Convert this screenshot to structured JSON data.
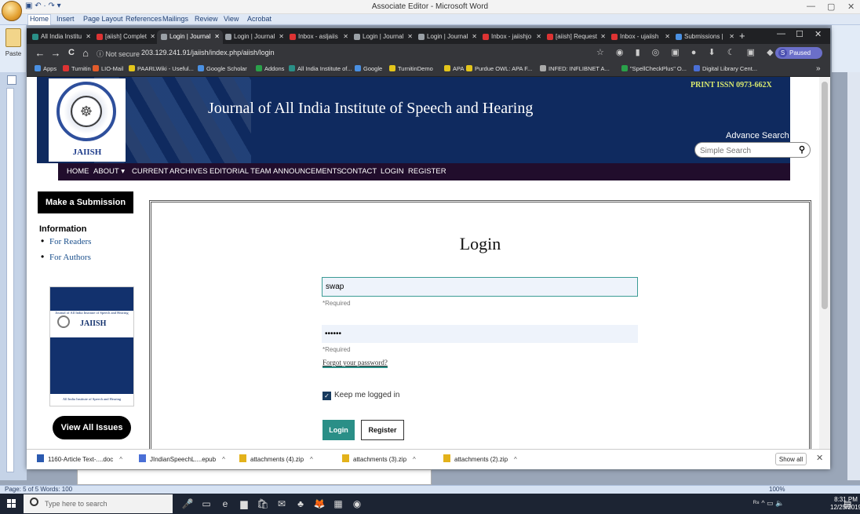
{
  "word": {
    "title": "Associate Editor - Microsoft Word",
    "qat": "▣ ↶ · ↷ ▾",
    "tabs": [
      "Home",
      "Insert",
      "Page Layout",
      "References",
      "Mailings",
      "Review",
      "View",
      "Acrobat"
    ],
    "paste_label": "Paste",
    "status_text": "Page: 5 of 5   Words: 100",
    "zoom": "100%",
    "win_controls": {
      "minimize": "—",
      "restore": "▢",
      "close": "✕"
    }
  },
  "browser": {
    "tabs": [
      {
        "label": "All India Institu",
        "color": "#2a8f87"
      },
      {
        "label": "[aiish] Complet",
        "color": "#d33"
      },
      {
        "label": "Login | Journal",
        "color": "#9aa0a6",
        "active": true
      },
      {
        "label": "Login | Journal",
        "color": "#9aa0a6"
      },
      {
        "label": "Inbox - asljaiis",
        "color": "#d33"
      },
      {
        "label": "Login | Journal",
        "color": "#9aa0a6"
      },
      {
        "label": "Login | Journal",
        "color": "#9aa0a6"
      },
      {
        "label": "Inbox - jaiishjo",
        "color": "#d33"
      },
      {
        "label": "[aiish] Request",
        "color": "#d33"
      },
      {
        "label": "Inbox - ujaiish",
        "color": "#d33"
      },
      {
        "label": "Submissions |",
        "color": "#4a90e2"
      }
    ],
    "new_tab": "+",
    "controls": {
      "minimize": "—",
      "maximize": "☐",
      "close": "✕"
    },
    "nav": {
      "back": "←",
      "forward": "→",
      "reload": "C",
      "home": "⌂"
    },
    "not_secure": "ⓘ Not secure",
    "url": "203.129.241.91/jaiish/index.php/aiish/login",
    "ext_icons": "☆ ◉ ▮ ◎ ▣ ● ⬇ ☾ ▣ ◆ ▦ ⊶",
    "profile": "Paused",
    "profile_initial": "S",
    "bookmarks": [
      {
        "label": "Apps",
        "color": "#4a90e2"
      },
      {
        "label": "Turnitin",
        "color": "#d33"
      },
      {
        "label": "LIO-Mail",
        "color": "#e25b2b"
      },
      {
        "label": "PAARLWiki - Useful...",
        "color": "#e3c51b"
      },
      {
        "label": "Google Scholar",
        "color": "#4a90e2"
      },
      {
        "label": "Addons",
        "color": "#2aa14a"
      },
      {
        "label": "All India Institute of...",
        "color": "#2a8f87"
      },
      {
        "label": "Google",
        "color": "#4a90e2"
      },
      {
        "label": "TurnitinDemo",
        "color": "#e3c51b"
      },
      {
        "label": "APA",
        "color": "#e3c51b"
      },
      {
        "label": "Purdue OWL: APA F...",
        "color": "#e3c51b"
      },
      {
        "label": "INFED: INFLIBNET A...",
        "color": "#aaa"
      },
      {
        "label": "\"SpellCheckPlus\" O...",
        "color": "#2aa14a"
      },
      {
        "label": "Digital Library Cent...",
        "color": "#4a6fd6"
      }
    ],
    "bookmarks_more": "»"
  },
  "journal": {
    "logo_text": "JAIISH",
    "title": "Journal of All India Institute of Speech and Hearing",
    "print_issn": "PRINT ISSN 0973-662X",
    "advance_search": "Advance Search",
    "search_placeholder": "Simple Search",
    "nav": [
      "HOME",
      "ABOUT ▾",
      "CURRENT",
      "ARCHIVES",
      "EDITORIAL TEAM",
      "ANNOUNCEMENTS",
      "CONTACT",
      "LOGIN",
      "REGISTER"
    ]
  },
  "sidebar": {
    "submit_label": "Make a Submission",
    "info_title": "Information",
    "info_links": [
      "For Readers",
      "For Authors"
    ],
    "cover": {
      "journal": "Journal of All India Institute of Speech and Hearing",
      "title": "JAIISH",
      "foot": "All India Institute of Speech and Hearing"
    },
    "view_issues": "View All Issues"
  },
  "login": {
    "title": "Login",
    "username_value": "swap",
    "password_value": "••••••",
    "required": "*Required",
    "forgot": "Forgot your password?",
    "keep_logged_in": "Keep me logged in",
    "keep_checked": true,
    "login_button": "Login",
    "register_button": "Register"
  },
  "downloads": {
    "items": [
      {
        "label": "1160-Article Text-....doc",
        "color": "#2b5ab0"
      },
      {
        "label": "JIndianSpeechL....epub",
        "color": "#4a6fd6"
      },
      {
        "label": "attachments (4).zip",
        "color": "#e3b21b"
      },
      {
        "label": "attachments (3).zip",
        "color": "#e3b21b"
      },
      {
        "label": "attachments (2).zip",
        "color": "#e3b21b"
      }
    ],
    "show_all": "Show all",
    "close": "✕"
  },
  "taskbar": {
    "search_text": "Type here to search",
    "apps": [
      "🎤",
      "▭",
      "e",
      "▆",
      "🛍",
      "✉",
      "♣",
      "🦊",
      "▦",
      "◉"
    ],
    "tray": "ᴿ⁸  ^  ▭ 🔈",
    "time": "8:31 PM",
    "date": "12/25/2019",
    "notif": "▤"
  }
}
